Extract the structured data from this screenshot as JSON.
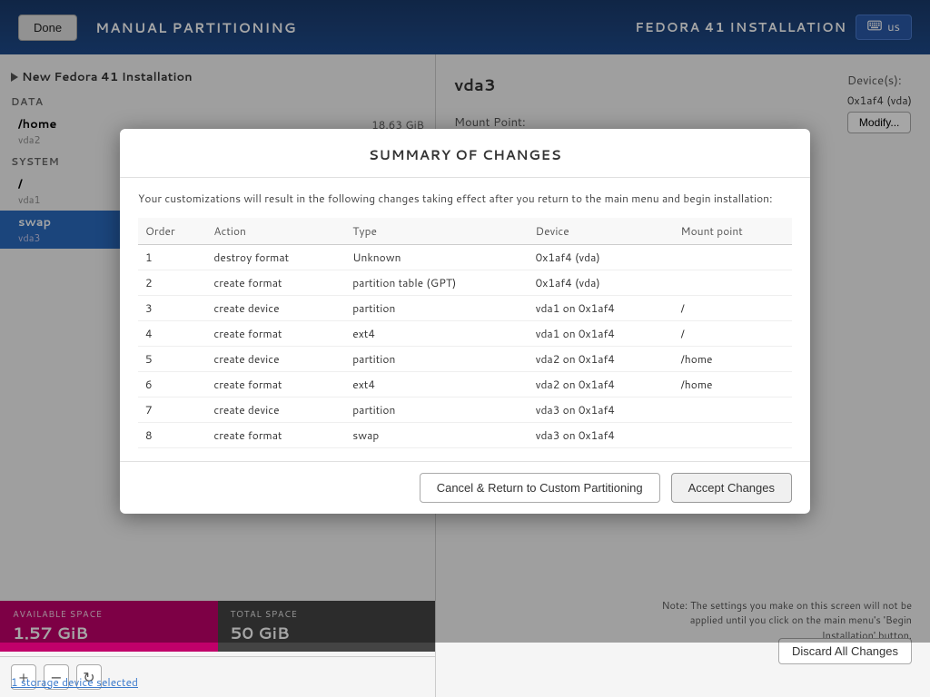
{
  "topbar": {
    "app_title": "MANUAL PARTITIONING",
    "done_label": "Done",
    "fedora_title": "FEDORA 41 INSTALLATION",
    "keyboard_locale": "us"
  },
  "left_panel": {
    "installation_label": "New Fedora 41 Installation",
    "sections": [
      {
        "name": "DATA",
        "partitions": [
          {
            "label": "/home",
            "device": "vda2",
            "size": "18.63 GiB",
            "active": false
          }
        ]
      },
      {
        "name": "SYSTEM",
        "partitions": [
          {
            "label": "/",
            "device": "vda1",
            "size": "",
            "active": false
          },
          {
            "label": "swap",
            "device": "vda3",
            "size": "",
            "active": true
          }
        ]
      }
    ],
    "available_space_label": "AVAILABLE SPACE",
    "available_space_value": "1.57 GiB",
    "total_space_label": "TOTAL SPACE",
    "total_space_value": "50 GiB",
    "storage_link": "1 storage device selected"
  },
  "right_panel": {
    "partition_title": "vda3",
    "mount_point_label": "Mount Point:",
    "devices_label": "Device(s):",
    "devices_value": "0x1af4 (vda)",
    "modify_label": "Modify...",
    "discard_all_label": "Discard All Changes",
    "note_text": "Note: The settings you make on this screen will not be applied until you click on the main menu's 'Begin Installation' button."
  },
  "dialog": {
    "title": "SUMMARY OF CHANGES",
    "description": "Your customizations will result in the following changes taking effect after you return to the main menu and begin installation:",
    "columns": [
      "Order",
      "Action",
      "Type",
      "Device",
      "Mount point"
    ],
    "rows": [
      {
        "order": "1",
        "action": "destroy format",
        "action_type": "destroy",
        "type": "Unknown",
        "device": "0x1af4 (vda)",
        "mount_point": ""
      },
      {
        "order": "2",
        "action": "create format",
        "action_type": "create",
        "type": "partition table (GPT)",
        "device": "0x1af4 (vda)",
        "mount_point": ""
      },
      {
        "order": "3",
        "action": "create device",
        "action_type": "create",
        "type": "partition",
        "device": "vda1 on 0x1af4",
        "mount_point": "/"
      },
      {
        "order": "4",
        "action": "create format",
        "action_type": "create",
        "type": "ext4",
        "device": "vda1 on 0x1af4",
        "mount_point": "/"
      },
      {
        "order": "5",
        "action": "create device",
        "action_type": "create",
        "type": "partition",
        "device": "vda2 on 0x1af4",
        "mount_point": "/home"
      },
      {
        "order": "6",
        "action": "create format",
        "action_type": "create",
        "type": "ext4",
        "device": "vda2 on 0x1af4",
        "mount_point": "/home"
      },
      {
        "order": "7",
        "action": "create device",
        "action_type": "create",
        "type": "partition",
        "device": "vda3 on 0x1af4",
        "mount_point": ""
      },
      {
        "order": "8",
        "action": "create format",
        "action_type": "create",
        "type": "swap",
        "device": "vda3 on 0x1af4",
        "mount_point": ""
      }
    ],
    "cancel_label": "Cancel & Return to Custom Partitioning",
    "accept_label": "Accept Changes"
  }
}
